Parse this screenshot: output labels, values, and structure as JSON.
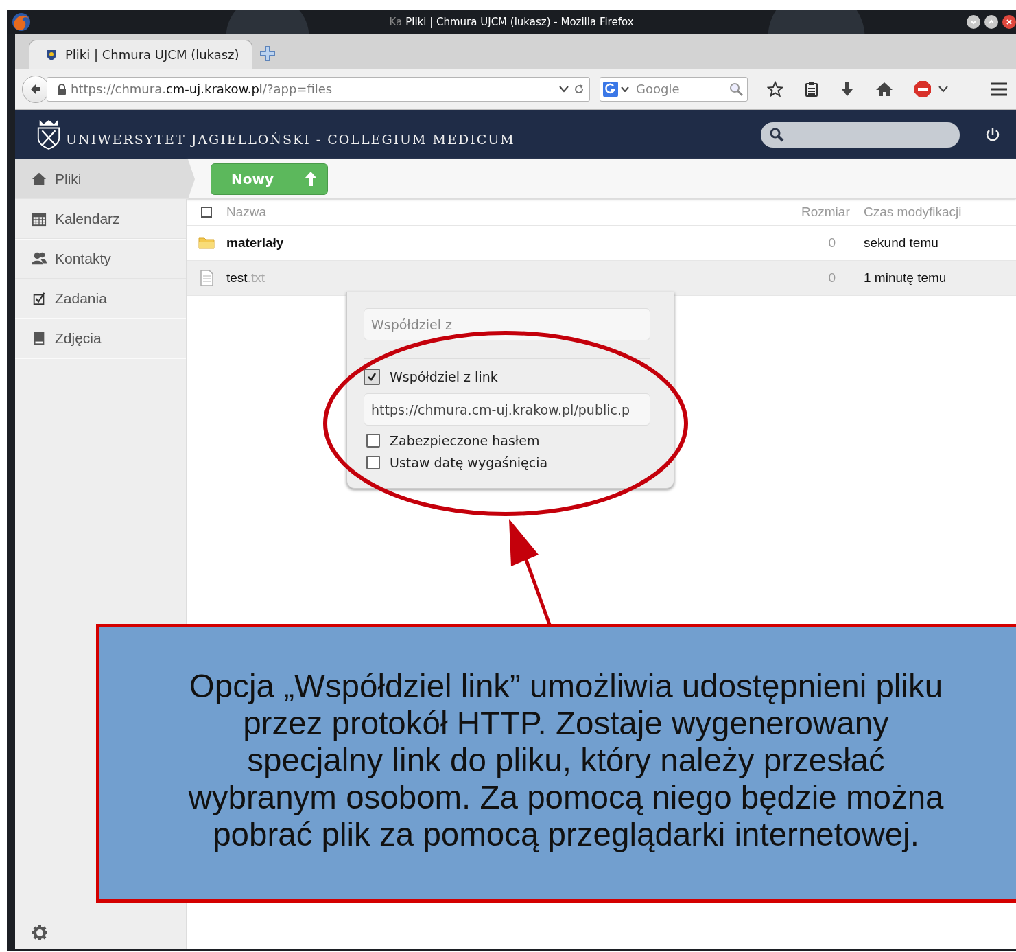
{
  "window": {
    "title_fragment": "Ka",
    "title": "Pliki | Chmura UJCM (lukasz) - Mozilla Firefox"
  },
  "tabs": [
    {
      "label": "Pliki | Chmura UJCM (lukasz)",
      "selected": true
    }
  ],
  "address_bar": {
    "url_prefix": "https://chmura.",
    "url_domain": "cm-uj.krakow.pl",
    "url_path": "/?app=files"
  },
  "search_bar": {
    "placeholder": "Google"
  },
  "header": {
    "logo_text": "UNIWERSYTET JAGIELLOŃSKI - COLLEGIUM MEDICUM"
  },
  "sidebar": {
    "items": [
      {
        "kind": "files",
        "label": "Pliki",
        "selected": true
      },
      {
        "kind": "calendar",
        "label": "Kalendarz",
        "selected": false
      },
      {
        "kind": "contacts",
        "label": "Kontakty",
        "selected": false
      },
      {
        "kind": "tasks",
        "label": "Zadania",
        "selected": false
      },
      {
        "kind": "photos",
        "label": "Zdjęcia",
        "selected": false
      }
    ]
  },
  "toolbar": {
    "new_button": "Nowy"
  },
  "file_table": {
    "select_all": {
      "checked": false
    },
    "columns": [
      "Nazwa",
      "Rozmiar",
      "Czas modyfikacji"
    ],
    "rows": [
      {
        "kind": "folder",
        "name": "materiały",
        "size": "0",
        "modified": "sekund temu",
        "highlighted": false
      },
      {
        "kind": "file",
        "name": "test",
        "extension": ".txt",
        "size": "0",
        "modified": "1 minutę temu",
        "highlighted": true
      }
    ]
  },
  "share_popup": {
    "share_with_placeholder": "Współdziel z",
    "link_share": {
      "label": "Współdziel z link",
      "checked": true
    },
    "link_value": "https://chmura.cm-uj.krakow.pl/public.p",
    "options": [
      {
        "label": "Zabezpieczone hasłem",
        "checked": false
      },
      {
        "label": "Ustaw datę wygaśnięcia",
        "checked": false
      }
    ]
  },
  "callout": {
    "text": "Opcja „Współdziel link” umożliwia udostępnieni pliku przez protokół HTTP. Zostaje wygenerowany specjalny link do pliku, który należy przesłać wybranym osobom. Za pomocą niego będzie można pobrać plik za pomocą przeglądarki internetowej."
  }
}
